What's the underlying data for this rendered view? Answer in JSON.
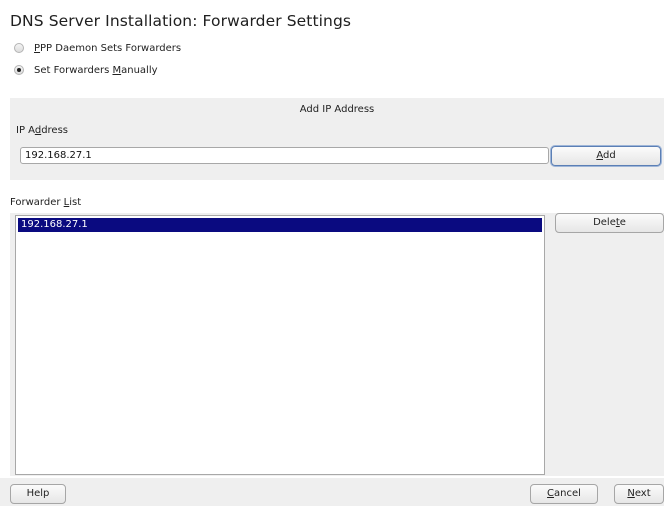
{
  "window": {
    "title": "DNS Server Installation: Forwarder Settings"
  },
  "forwarder_mode": {
    "options": [
      {
        "pre": "",
        "key": "P",
        "post": "PP Daemon Sets Forwarders",
        "checked": false
      },
      {
        "pre": "Set Forwarders ",
        "key": "M",
        "post": "anually",
        "checked": true
      }
    ]
  },
  "add_panel": {
    "title": "Add IP Address",
    "ip_label": {
      "pre": "IP A",
      "key": "d",
      "post": "dress"
    },
    "ip_value": "192.168.27.1",
    "add_button": {
      "pre": "",
      "key": "A",
      "post": "dd"
    }
  },
  "forwarder_list": {
    "label": {
      "pre": "Forwarder ",
      "key": "L",
      "post": "ist"
    },
    "items": [
      "192.168.27.1"
    ],
    "selected_index": 0,
    "delete_button": {
      "pre": "Dele",
      "key": "t",
      "post": "e"
    }
  },
  "footer": {
    "help": "Help",
    "cancel": {
      "pre": "",
      "key": "C",
      "post": "ancel"
    },
    "next": {
      "pre": "",
      "key": "N",
      "post": "ext"
    }
  },
  "colors": {
    "selection": "#0a0a80",
    "panel_bg": "#efefef",
    "focus_border": "#5b7fb5"
  }
}
